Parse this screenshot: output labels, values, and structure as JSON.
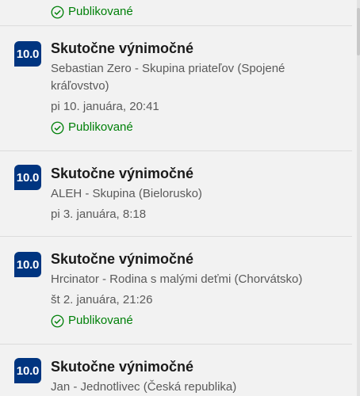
{
  "partial_item": {
    "status": "Publikované"
  },
  "reviews": [
    {
      "score": "10.0",
      "title": "Skutočne výnimočné",
      "reviewer": "Sebastian Zero - Skupina priateľov (Spojené kráľovstvo)",
      "date": "pi 10. januára, 20:41",
      "status": "Publikované"
    },
    {
      "score": "10.0",
      "title": "Skutočne výnimočné",
      "reviewer": "ALEH - Skupina (Bielorusko)",
      "date": "pi 3. januára, 8:18",
      "status": ""
    },
    {
      "score": "10.0",
      "title": "Skutočne výnimočné",
      "reviewer": "Hrcinator - Rodina s malými deťmi (Chorvátsko)",
      "date": "št 2. januára, 21:26",
      "status": "Publikované"
    },
    {
      "score": "10.0",
      "title": "Skutočne výnimočné",
      "reviewer": "Jan - Jednotlivec (Česká republika)",
      "date": "",
      "status": ""
    }
  ],
  "colors": {
    "badge": "#003580",
    "published": "#008009"
  }
}
